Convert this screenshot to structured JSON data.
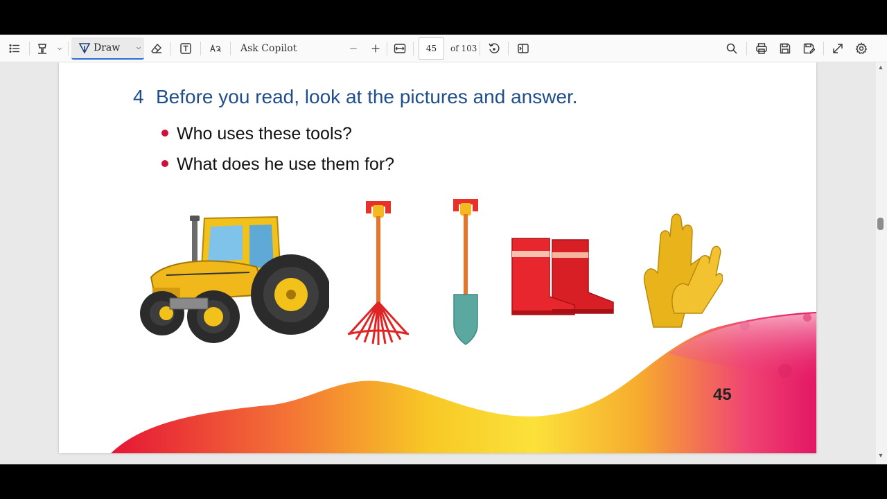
{
  "toolbar": {
    "draw_label": "Draw",
    "ask_copilot_label": "Ask Copilot",
    "current_page": "45",
    "total_pages_label": "of 103"
  },
  "page": {
    "exercise_number": "4",
    "exercise_title": "Before you read, look at the pictures and answer.",
    "questions": [
      "Who uses these tools?",
      "What does he use them for?"
    ],
    "page_number": "45"
  },
  "colors": {
    "title_blue": "#1f4e8c",
    "bullet_red": "#d0103a",
    "accent_blue": "#2b6fd6"
  }
}
